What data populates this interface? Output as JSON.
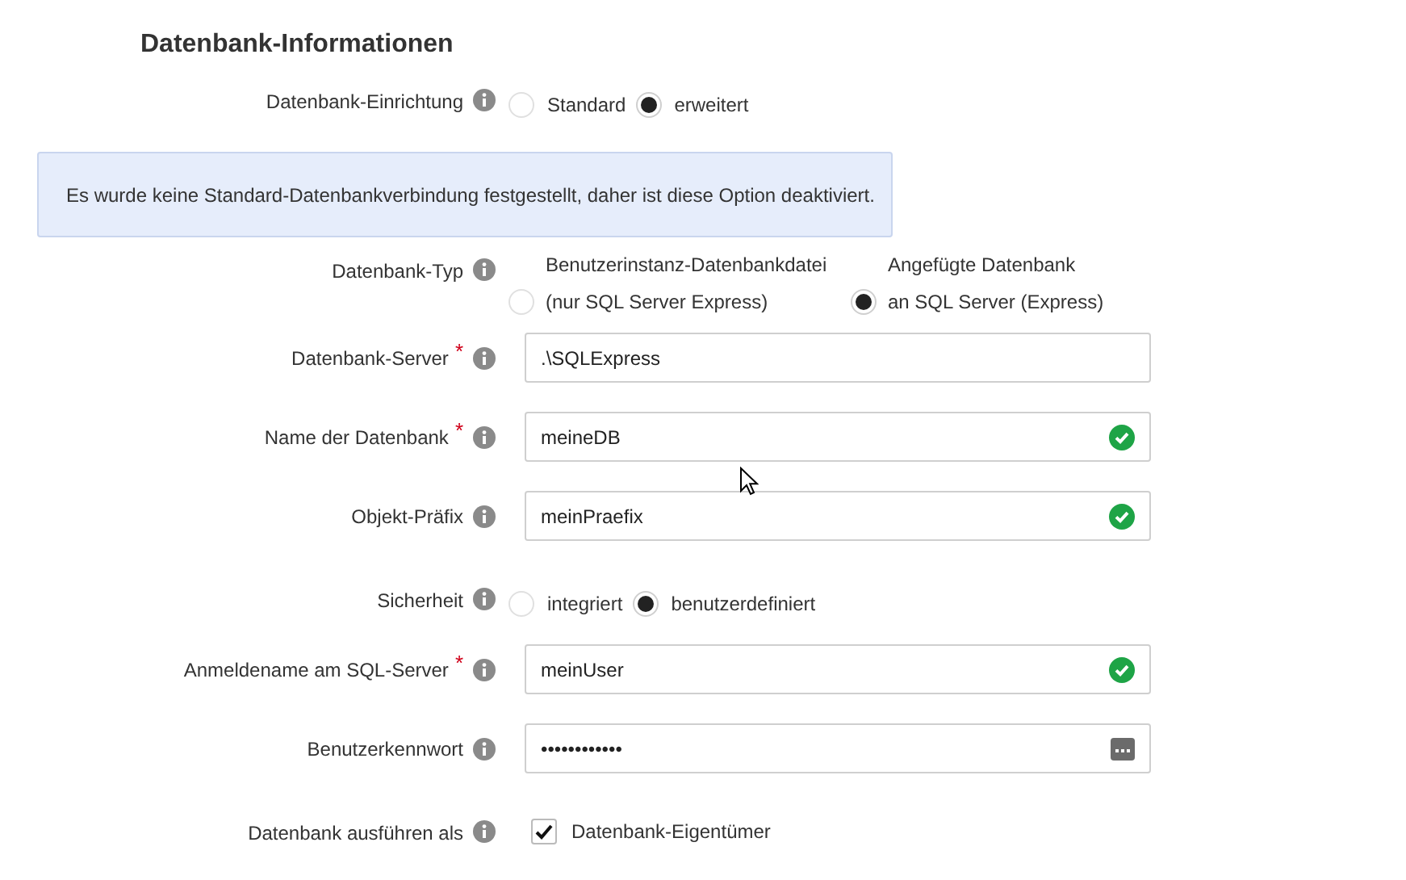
{
  "title": "Datenbank-Informationen",
  "rows": [
    {
      "kind": "radio",
      "label": "Datenbank-Einrichtung",
      "options": [
        {
          "label": "Standard",
          "selected": false
        },
        {
          "label": "erweitert",
          "selected": true
        }
      ]
    },
    {
      "kind": "notice",
      "text": "Es wurde keine Standard-Datenbankverbindung festgestellt, daher ist diese Option deaktiviert."
    },
    {
      "kind": "radio",
      "label": "Datenbank-Typ",
      "options": [
        {
          "label": "Benutzerinstanz-Datenbankdatei",
          "sublabel": "(nur SQL Server Express)",
          "selected": false
        },
        {
          "label": "Angefügte Datenbank",
          "sublabel": "an SQL Server (Express)",
          "selected": true
        }
      ]
    },
    {
      "kind": "field",
      "label": "Datenbank-Server",
      "required_mark": "*",
      "value": ".\\SQLExpress",
      "valid": false
    },
    {
      "kind": "field",
      "label": "Name der Datenbank",
      "required_mark": "*",
      "value": "meineDB",
      "valid": true
    },
    {
      "kind": "field",
      "label": "Objekt-Präfix",
      "value": "meinPraefix",
      "valid": true
    },
    {
      "kind": "radio",
      "label": "Sicherheit",
      "options": [
        {
          "label": "integriert",
          "selected": false
        },
        {
          "label": "benutzerdefiniert",
          "selected": true
        }
      ]
    },
    {
      "kind": "field",
      "label": "Anmeldename am SQL-Server",
      "required_mark": "*",
      "value": "meinUser",
      "valid": true
    },
    {
      "kind": "password",
      "label": "Benutzerkennwort",
      "value": "••••••••••••"
    },
    {
      "kind": "checkbox",
      "label": "Datenbank ausführen als",
      "option": {
        "label": "Datenbank-Eigentümer",
        "checked": true
      }
    }
  ]
}
